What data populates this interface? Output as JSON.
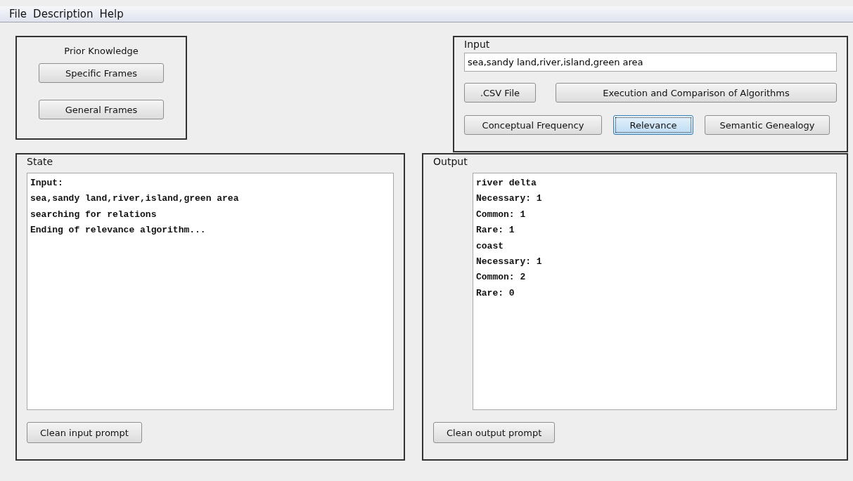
{
  "menu_bar": [
    "File",
    "Description",
    "Help"
  ],
  "prior_knowledge": {
    "title": "Prior Knowledge",
    "buttons": [
      "Specific Frames",
      "General Frames"
    ]
  },
  "input_panel": {
    "title": "Input",
    "value": "sea,sandy land,river,island,green area",
    "button_rows": [
      [
        {
          "label": ".CSV File",
          "focused": false
        },
        {
          "label": "Execution and Comparison of Algorithms",
          "focused": false
        }
      ],
      [
        {
          "label": "Conceptual Frequency",
          "focused": false
        },
        {
          "label": "Relevance",
          "focused": true
        },
        {
          "label": "Semantic Genealogy",
          "focused": false
        }
      ]
    ]
  },
  "state_panel": {
    "title": "State",
    "lines": [
      "Input:",
      "sea,sandy land,river,island,green area",
      "searching for relations",
      "Ending of relevance algorithm..."
    ],
    "button": "Clean input prompt"
  },
  "output_panel": {
    "title": "Output",
    "lines": [
      "river delta",
      "Necessary: 1",
      "Common: 1",
      "Rare: 1",
      "coast",
      "Necessary: 1",
      "Common: 2",
      "Rare: 0"
    ],
    "button": "Clean output prompt"
  }
}
